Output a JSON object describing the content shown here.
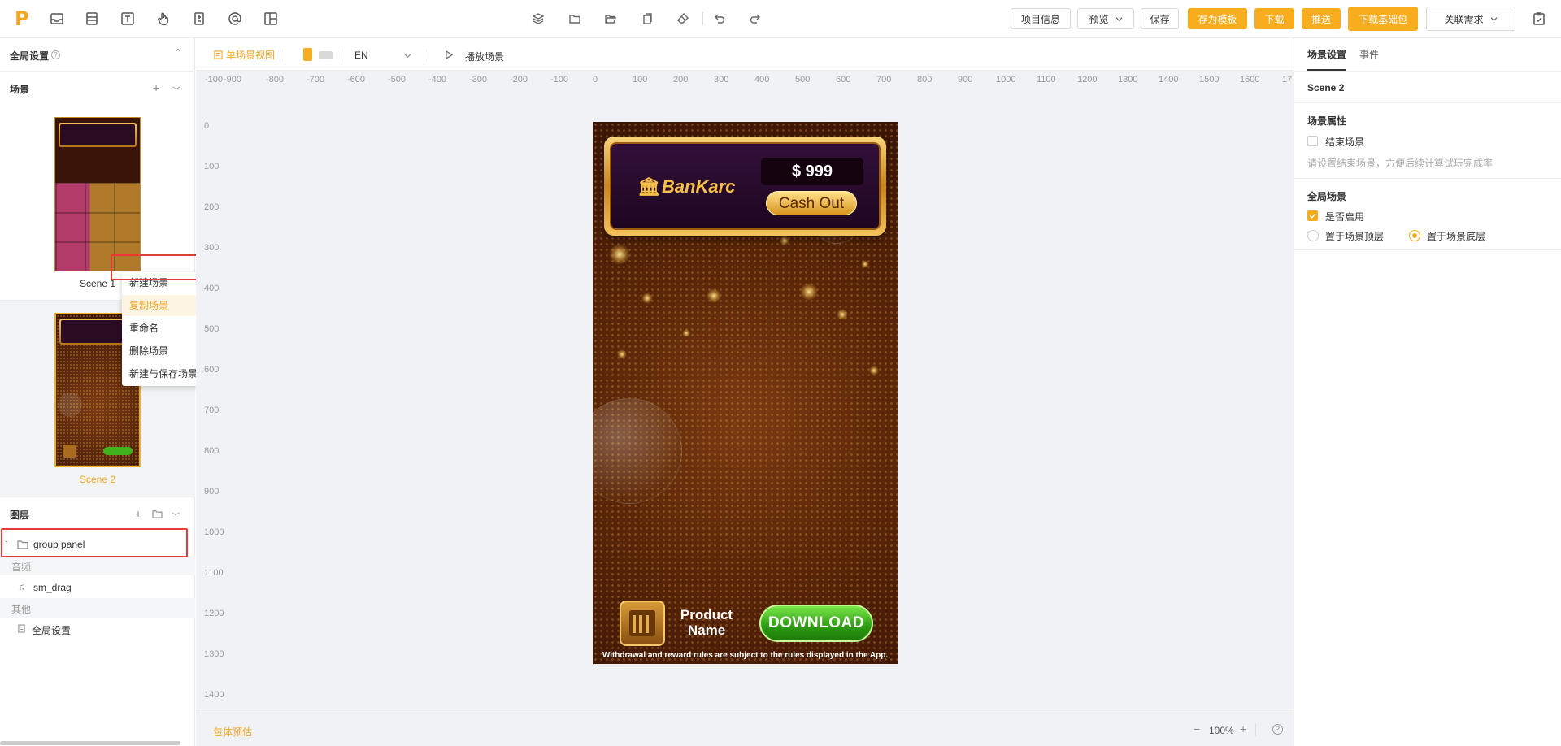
{
  "colors": {
    "accent": "#f7ad1e",
    "highlight_box": "#e43a3a"
  },
  "toolbar": {
    "left_icons": [
      "inbox-icon",
      "layout-icon",
      "text-icon",
      "hand-pointer-icon",
      "doc-icon",
      "at-icon",
      "grid-layout-icon"
    ],
    "center_icons": [
      "layers-icon",
      "folder-icon",
      "folder-open-icon",
      "copy-icon",
      "eraser-icon",
      "undo-icon",
      "redo-icon"
    ],
    "project_info": "项目信息",
    "preview": "预览",
    "save": "保存",
    "save_template": "存为模板",
    "download": "下载",
    "push": "推送",
    "download_base": "下载基础包",
    "linked_requirements": "关联需求"
  },
  "left": {
    "global_settings": "全局设置",
    "scenes_title": "场景",
    "scenes": [
      {
        "label": "Scene 1"
      },
      {
        "label": "Scene 2"
      }
    ],
    "context_menu": [
      "新建场景",
      "复制场景",
      "重命名",
      "删除场景",
      "新建与保存场景"
    ],
    "layers_title": "图层",
    "layer_item": "group panel",
    "audio_group": "音频",
    "audio_item": "sm_drag",
    "other_group": "其他",
    "other_item": "全局设置"
  },
  "canvas": {
    "view_mode": "单场景视图",
    "language": "EN",
    "play": "播放场景",
    "ruler_x": [
      "-100",
      "-900",
      "-800",
      "-700",
      "-600",
      "-500",
      "-400",
      "-300",
      "-200",
      "-100",
      "0",
      "100",
      "200",
      "300",
      "400",
      "500",
      "600",
      "700",
      "800",
      "900",
      "1000",
      "1100",
      "1200",
      "1300",
      "1400",
      "1500",
      "1600",
      "17"
    ],
    "ruler_y": [
      "0",
      "100",
      "200",
      "300",
      "400",
      "500",
      "600",
      "700",
      "800",
      "900",
      "1000",
      "1100",
      "1200",
      "1300",
      "1400"
    ],
    "package_estimate": "包体预估",
    "zoom": "100%"
  },
  "preview": {
    "bank_name": "BanKarc",
    "amount": "$ 999",
    "cash_out": "Cash Out",
    "product_name": "Product Name",
    "download": "DOWNLOAD",
    "disclaimer": "Withdrawal and reward rules are subject to the rules displayed in the App."
  },
  "right": {
    "tabs": [
      "场景设置",
      "事件"
    ],
    "scene_name": "Scene 2",
    "scene_props_title": "场景属性",
    "end_scene": "结束场景",
    "end_scene_hint": "请设置结束场景，方便后续计算试玩完成率",
    "global_scene_title": "全局场景",
    "enable": "是否启用",
    "place_top": "置于场景顶层",
    "place_bottom": "置于场景底层"
  }
}
